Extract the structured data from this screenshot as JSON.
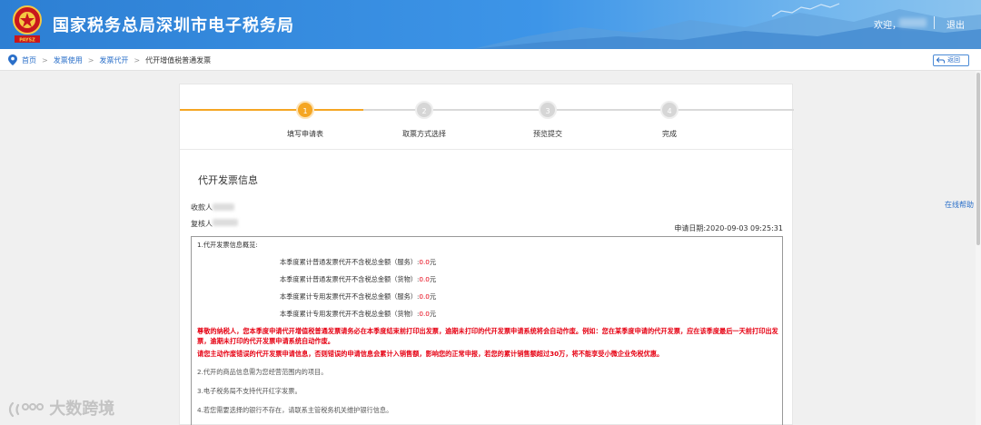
{
  "header": {
    "title": "国家税务总局深圳市电子税务局",
    "welcome": "欢迎，",
    "logout": "退出",
    "emblem_text": "PAYSZ"
  },
  "breadcrumb": {
    "items": [
      "首页",
      "发票使用",
      "发票代开"
    ],
    "current": "代开增值税普通发票",
    "separator": ">",
    "back_label": "返回"
  },
  "steps": [
    {
      "num": "1",
      "label": "填写申请表",
      "active": true
    },
    {
      "num": "2",
      "label": "取票方式选择",
      "active": false
    },
    {
      "num": "3",
      "label": "预览提交",
      "active": false
    },
    {
      "num": "4",
      "label": "完成",
      "active": false
    }
  ],
  "form": {
    "section_title": "代开发票信息",
    "payee_label": "收款人",
    "reviewer_label": "复核人",
    "apply_date": "申请日期:2020-09-03 09:25:31"
  },
  "info": {
    "line1": "1.代开发票信息概览:",
    "stats": [
      {
        "label": "本季度累计普通发票代开不含税总金额（服务）:",
        "amount": "0.0",
        "unit": "元"
      },
      {
        "label": "本季度累计普通发票代开不含税总金额（货物）:",
        "amount": "0.0",
        "unit": "元"
      },
      {
        "label": "本季度累计专用发票代开不含税总金额（服务）:",
        "amount": "0.0",
        "unit": "元"
      },
      {
        "label": "本季度累计专用发票代开不含税总金额（货物）:",
        "amount": "0.0",
        "unit": "元"
      }
    ],
    "warning1": "尊敬的纳税人，您本季度申请代开增值税普通发票请务必在本季度结束前打印出发票，逾期未打印的代开发票申请系统将会自动作废。例如：您在某季度申请的代开发票，应在该季度最后一天前打印出发票，逾期未打印的代开发票申请系统自动作废。",
    "warning2": "请您主动作废错误的代开发票申请信息，否则错误的申请信息会累计入销售额，影响您的正常申报，若您的累计销售额超过30万，将不能享受小微企业免税优惠。",
    "line2": "2.代开的商品信息需为您经营范围内的项目。",
    "line3": "3.电子税务局不支持代开红字发票。",
    "line4": "4.若您需要选择的银行不存在，请联系主管税务机关维护银行信息。"
  },
  "help_link": "在线帮助",
  "watermark": "大数跨境",
  "colors": {
    "header_blue": "#2d7fd3",
    "step_active": "#f5a623",
    "link_blue": "#2a6fc9",
    "warning_red": "#e60012"
  }
}
